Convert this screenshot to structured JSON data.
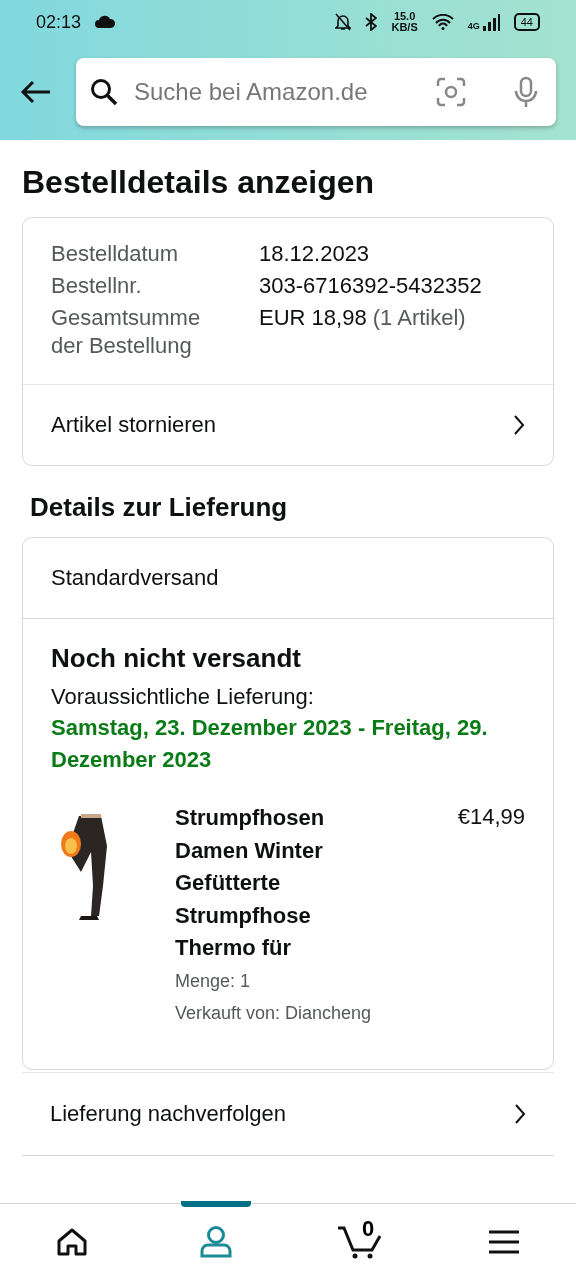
{
  "status_bar": {
    "time": "02:13",
    "speed": "15.0",
    "speed_unit": "KB/S",
    "network": "4G",
    "battery": "44"
  },
  "search": {
    "placeholder": "Suche bei Amazon.de"
  },
  "title": "Bestelldetails anzeigen",
  "order": {
    "rows": [
      {
        "label": "Bestelldatum",
        "value": "18.12.2023"
      },
      {
        "label": "Bestellnr.",
        "value": "303-6716392-5432352"
      },
      {
        "label": "Gesamtsumme der Bestellung",
        "value": "EUR 18,98",
        "note": "(1 Artikel)"
      }
    ],
    "action": "Artikel stornieren"
  },
  "delivery_heading": "Details zur Lieferung",
  "shipment": {
    "method": "Standardversand",
    "status": "Noch nicht versandt",
    "expected_label": "Voraussichtliche Lieferung:",
    "expected_date": "Samstag, 23. Dezember 2023 - Freitag, 29. Dezember 2023",
    "item": {
      "kind": "picture",
      "title": "Strumpfhosen Damen Winter Gefütterte Strumpfhose Thermo für",
      "price": "€14,99",
      "quantity": "Menge: 1",
      "seller": "Verkauft von: Diancheng"
    }
  },
  "links": [
    "Lieferung nachverfolgen"
  ],
  "nav": [
    {
      "kind": "home",
      "selected": false
    },
    {
      "kind": "account",
      "selected": true
    },
    {
      "kind": "cart",
      "selected": false,
      "count": "0"
    },
    {
      "kind": "menu",
      "selected": false
    }
  ]
}
